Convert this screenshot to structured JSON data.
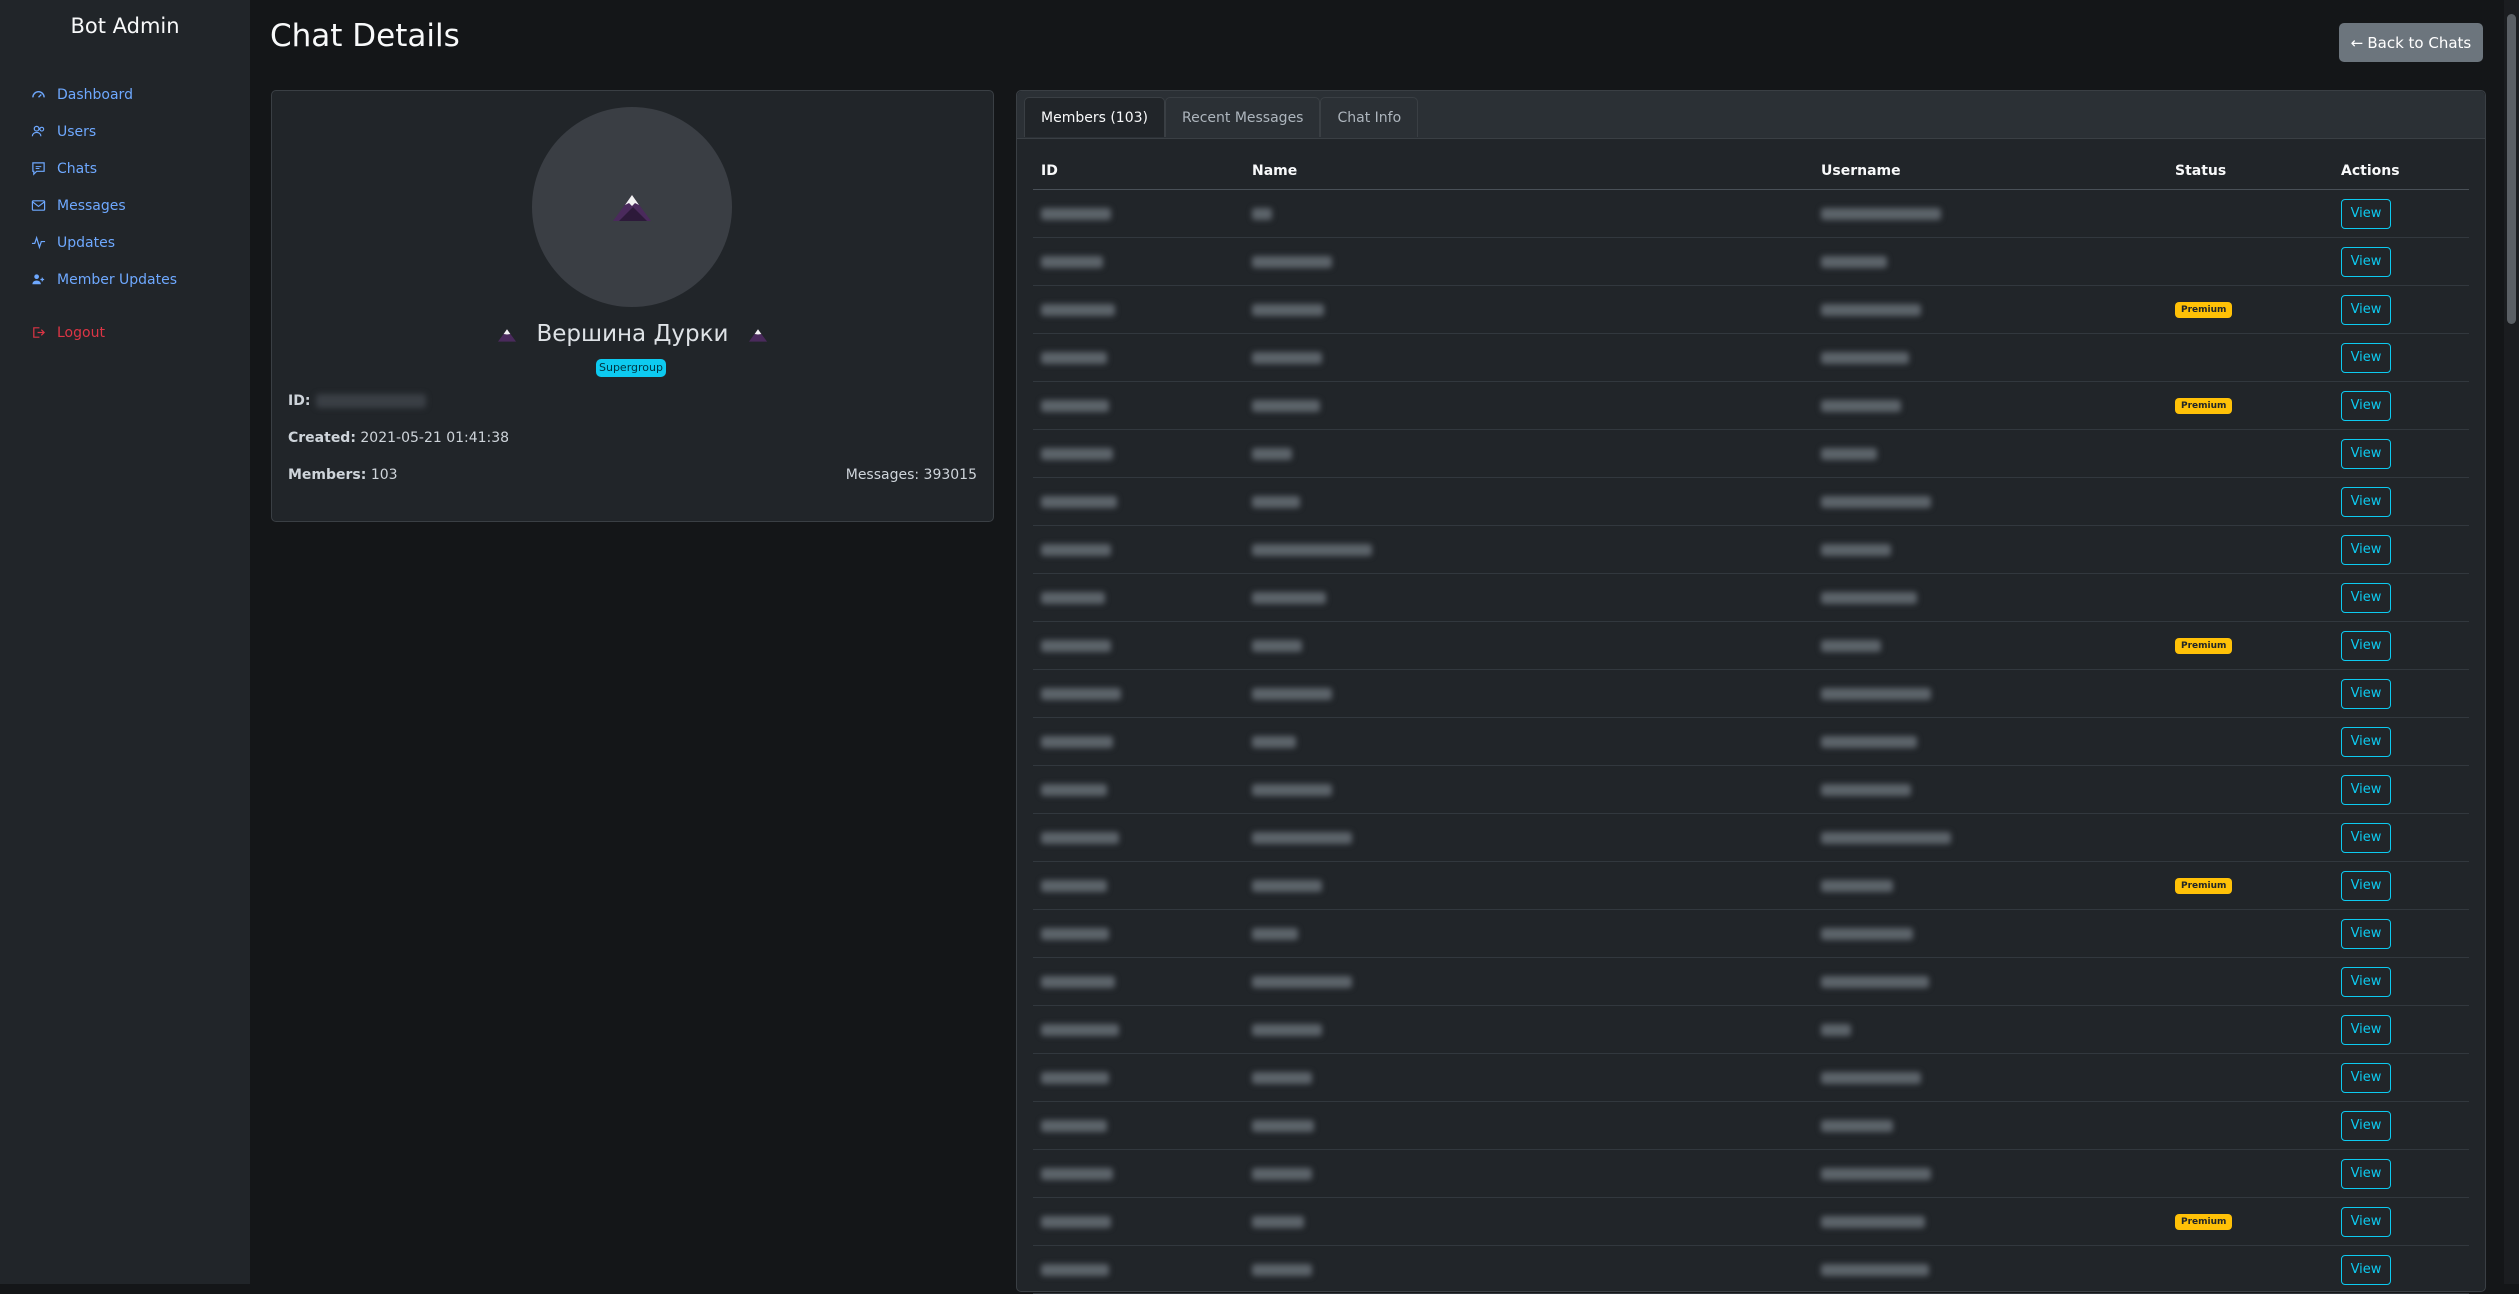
{
  "sidebar": {
    "brand": "Bot Admin",
    "items": [
      {
        "label": "Dashboard",
        "icon": "dashboard-icon"
      },
      {
        "label": "Users",
        "icon": "users-icon"
      },
      {
        "label": "Chats",
        "icon": "chats-icon"
      },
      {
        "label": "Messages",
        "icon": "messages-icon"
      },
      {
        "label": "Updates",
        "icon": "updates-icon"
      },
      {
        "label": "Member Updates",
        "icon": "member-updates-icon"
      }
    ],
    "logout_label": "Logout"
  },
  "header": {
    "title": "Chat Details",
    "back_label": "Back to Chats",
    "back_icon": "arrow-left-icon"
  },
  "chat": {
    "name": "Вершина Дурки",
    "type_badge": "Supergroup",
    "id_label": "ID:",
    "created_label": "Created:",
    "created_value": "2021-05-21 01:41:38",
    "members_label": "Members:",
    "members_value": "103",
    "messages_text": "Messages: 393015"
  },
  "tabs": [
    {
      "label": "Members (103)",
      "active": true
    },
    {
      "label": "Recent Messages",
      "active": false
    },
    {
      "label": "Chat Info",
      "active": false
    }
  ],
  "table": {
    "columns": [
      "ID",
      "Name",
      "Username",
      "Status",
      "Actions"
    ],
    "action_label": "View",
    "premium_label": "Premium",
    "rows": [
      {
        "premium": false
      },
      {
        "premium": false
      },
      {
        "premium": true
      },
      {
        "premium": false
      },
      {
        "premium": true
      },
      {
        "premium": false
      },
      {
        "premium": false
      },
      {
        "premium": false
      },
      {
        "premium": false
      },
      {
        "premium": true
      },
      {
        "premium": false
      },
      {
        "premium": false
      },
      {
        "premium": false
      },
      {
        "premium": false
      },
      {
        "premium": true
      },
      {
        "premium": false
      },
      {
        "premium": false
      },
      {
        "premium": false
      },
      {
        "premium": false
      },
      {
        "premium": false
      },
      {
        "premium": false
      },
      {
        "premium": true
      },
      {
        "premium": false
      }
    ]
  },
  "colors": {
    "accent": "#0dcaf0",
    "link": "#6ea8fe",
    "logout": "#dc3545",
    "premium": "#ffc107",
    "background": "#141618",
    "sidebar": "#212529"
  }
}
